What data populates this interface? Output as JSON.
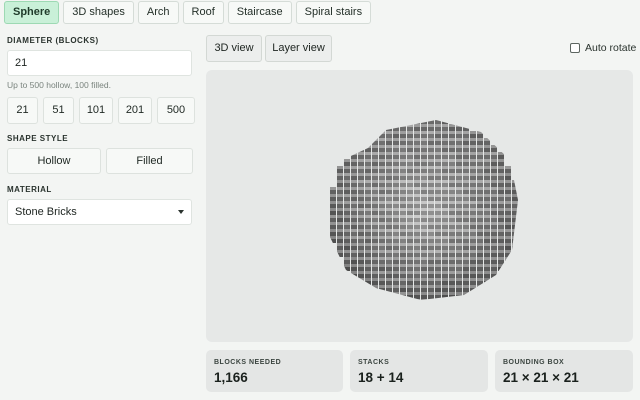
{
  "tabs": [
    {
      "label": "Sphere",
      "active": true
    },
    {
      "label": "3D shapes",
      "active": false
    },
    {
      "label": "Arch",
      "active": false
    },
    {
      "label": "Roof",
      "active": false
    },
    {
      "label": "Staircase",
      "active": false
    },
    {
      "label": "Spiral stairs",
      "active": false
    }
  ],
  "diameter": {
    "label": "DIAMETER (BLOCKS)",
    "value": "21",
    "hint": "Up to 500 hollow, 100 filled.",
    "presets": [
      "21",
      "51",
      "101",
      "201",
      "500"
    ]
  },
  "shape_style": {
    "label": "SHAPE STYLE",
    "options": [
      "Hollow",
      "Filled"
    ]
  },
  "material": {
    "label": "MATERIAL",
    "selected": "Stone Bricks"
  },
  "views": {
    "options": [
      "3D view",
      "Layer view"
    ],
    "auto_rotate_label": "Auto rotate",
    "auto_rotate_checked": false
  },
  "viewport": {
    "background": "#e6e8e7",
    "block_color": "#9b9b9b"
  },
  "stats": [
    {
      "label": "BLOCKS NEEDED",
      "value": "1,166"
    },
    {
      "label": "STACKS",
      "value": "18 + 14"
    },
    {
      "label": "BOUNDING BOX",
      "value": "21 × 21 × 21"
    }
  ],
  "colors": {
    "accent_tab_bg": "#c9f0d8",
    "page_bg": "#f3f5f3"
  }
}
